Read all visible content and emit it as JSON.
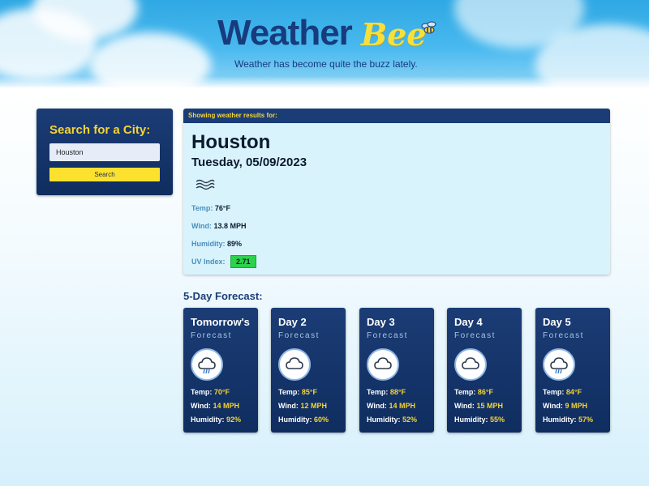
{
  "header": {
    "logo_main": "Weather",
    "logo_accent": "Bee",
    "tagline": "Weather has become quite the buzz lately."
  },
  "search": {
    "title": "Search for a City:",
    "input_value": "Houston",
    "button_label": "Search"
  },
  "current": {
    "heading": "Showing weather results for:",
    "city": "Houston",
    "date": "Tuesday, 05/09/2023",
    "icon": "haze-icon",
    "temp_label": "Temp:",
    "temp_value": "76°F",
    "wind_label": "Wind:",
    "wind_value": "13.8 MPH",
    "humidity_label": "Humidity:",
    "humidity_value": "89%",
    "uv_label": "UV Index:",
    "uv_value": "2.71",
    "uv_color": "#2bd34a"
  },
  "forecast": {
    "title": "5-Day Forecast:",
    "sub_label": "Forecast",
    "temp_label": "Temp:",
    "wind_label": "Wind:",
    "humidity_label": "Humidity:",
    "days": [
      {
        "day": "Tomorrow's",
        "icon": "rain-cloud-icon",
        "temp": "70°F",
        "wind": "14 MPH",
        "humidity": "92%"
      },
      {
        "day": "Day 2",
        "icon": "cloud-icon",
        "temp": "85°F",
        "wind": "12 MPH",
        "humidity": "60%"
      },
      {
        "day": "Day 3",
        "icon": "cloud-icon",
        "temp": "88°F",
        "wind": "14 MPH",
        "humidity": "52%"
      },
      {
        "day": "Day 4",
        "icon": "cloud-icon",
        "temp": "86°F",
        "wind": "15 MPH",
        "humidity": "55%"
      },
      {
        "day": "Day 5",
        "icon": "rain-cloud-icon",
        "temp": "84°F",
        "wind": "9 MPH",
        "humidity": "57%"
      }
    ]
  },
  "colors": {
    "navy": "#1a3d78",
    "accent_yellow": "#f6d434",
    "panel_light": "#d9f3fd"
  }
}
